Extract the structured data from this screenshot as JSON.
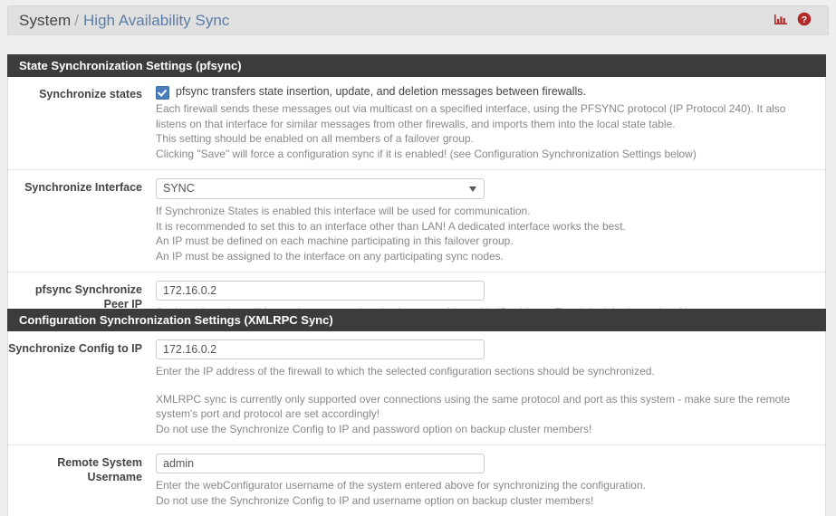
{
  "header": {
    "breadcrumb_root": "System",
    "breadcrumb_separator": "/",
    "breadcrumb_current": "High Availability Sync",
    "chart_icon": "bar-chart-icon",
    "help_icon": "help-circle-icon",
    "icon_color": "#b02a2a"
  },
  "sections": [
    {
      "title": "State Synchronization Settings (pfsync)",
      "rows": [
        {
          "label": "Synchronize states",
          "checkbox_checked": true,
          "checkbox_label": "pfsync transfers state insertion, update, and deletion messages between firewalls.",
          "help": [
            "Each firewall sends these messages out via multicast on a specified interface, using the PFSYNC protocol (IP Protocol 240). It also listens on that interface for similar messages from other firewalls, and imports them into the local state table.",
            "This setting should be enabled on all members of a failover group.",
            "Clicking \"Save\" will force a configuration sync if it is enabled! (see Configuration Synchronization Settings below)"
          ]
        },
        {
          "label": "Synchronize Interface",
          "select_value": "SYNC",
          "help": [
            "If Synchronize States is enabled this interface will be used for communication.",
            "It is recommended to set this to an interface other than LAN! A dedicated interface works the best.",
            "An IP must be defined on each machine participating in this failover group.",
            "An IP must be assigned to the interface on any participating sync nodes."
          ]
        },
        {
          "label": "pfsync Synchronize Peer IP",
          "input_value": "172.16.0.2",
          "help": [
            "Setting this option will force pfsync to synchronize its state table to this IP address. The default is directed multicast."
          ]
        }
      ]
    },
    {
      "title": "Configuration Synchronization Settings (XMLRPC Sync)",
      "rows": [
        {
          "label": "Synchronize Config to IP",
          "input_value": "172.16.0.2",
          "help": [
            "Enter the IP address of the firewall to which the selected configuration sections should be synchronized."
          ],
          "help_spaced": [
            "XMLRPC sync is currently only supported over connections using the same protocol and port as this system - make sure the remote system's port and protocol are set accordingly!",
            "Do not use the Synchronize Config to IP and password option on backup cluster members!"
          ]
        },
        {
          "label": "Remote System Username",
          "input_value": "admin",
          "help": [
            "Enter the webConfigurator username of the system entered above for synchronizing the configuration.",
            "Do not use the Synchronize Config to IP and username option on backup cluster members!"
          ]
        }
      ]
    }
  ]
}
